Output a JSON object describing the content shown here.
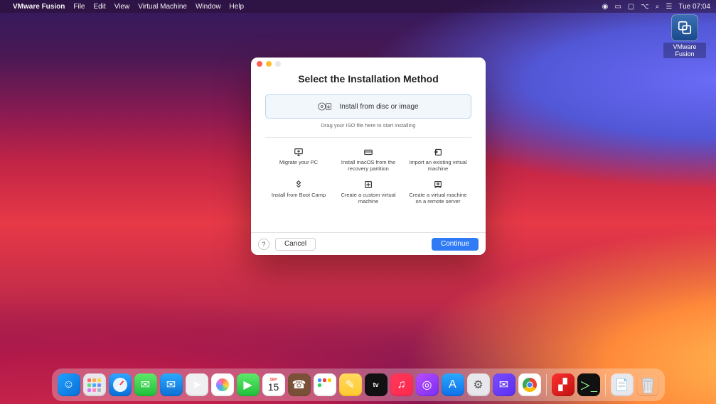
{
  "menubar": {
    "app": "VMware Fusion",
    "items": [
      "File",
      "Edit",
      "View",
      "Virtual Machine",
      "Window",
      "Help"
    ],
    "clock": "Tue 07:04"
  },
  "desktop_icon": {
    "label": "VMware Fusion"
  },
  "dialog": {
    "title": "Select the Installation Method",
    "primary_option": "Install from disc or image",
    "drag_hint": "Drag your ISO file here to start installing",
    "options": [
      "Migrate your PC",
      "Install macOS from the recovery partition",
      "Import an existing virtual machine",
      "Install from Boot Camp",
      "Create a custom virtual machine",
      "Create a virtual machine on a remote server"
    ],
    "help": "?",
    "cancel": "Cancel",
    "continue": "Continue"
  },
  "dock": {
    "calendar": {
      "month": "SEP",
      "day": "15"
    },
    "tv": "tv"
  }
}
